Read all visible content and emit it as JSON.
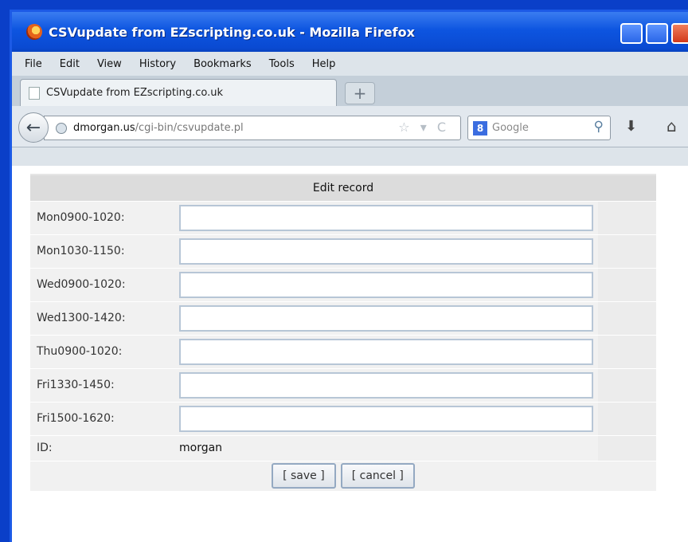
{
  "window": {
    "title": "CSVupdate from EZscripting.co.uk - Mozilla Firefox"
  },
  "menu": [
    "File",
    "Edit",
    "View",
    "History",
    "Bookmarks",
    "Tools",
    "Help"
  ],
  "tab": {
    "title": "CSVupdate from EZscripting.co.uk",
    "new_tab": "+"
  },
  "nav": {
    "back": "←",
    "url_host": "dmorgan.us",
    "url_path": "/cgi-bin/csvupdate.pl",
    "url_icons": "☆ ▾ C",
    "search_engine": "8",
    "search_placeholder": "Google",
    "search_icon": "⚲",
    "download_icon": "⬇",
    "home_icon": "⌂"
  },
  "form": {
    "header": "Edit record",
    "fields": [
      {
        "label": "Mon0900-1020:",
        "value": ""
      },
      {
        "label": "Mon1030-1150:",
        "value": ""
      },
      {
        "label": "Wed0900-1020:",
        "value": ""
      },
      {
        "label": "Wed1300-1420:",
        "value": ""
      },
      {
        "label": "Thu0900-1020:",
        "value": ""
      },
      {
        "label": "Fri1330-1450:",
        "value": ""
      },
      {
        "label": "Fri1500-1620:",
        "value": ""
      }
    ],
    "id_label": "ID:",
    "id_value": "morgan",
    "save_label": "[ save ]",
    "cancel_label": "[ cancel ]"
  },
  "colors": {
    "titlebar": "#0d55e0",
    "desktop": "#0a3fc8"
  }
}
